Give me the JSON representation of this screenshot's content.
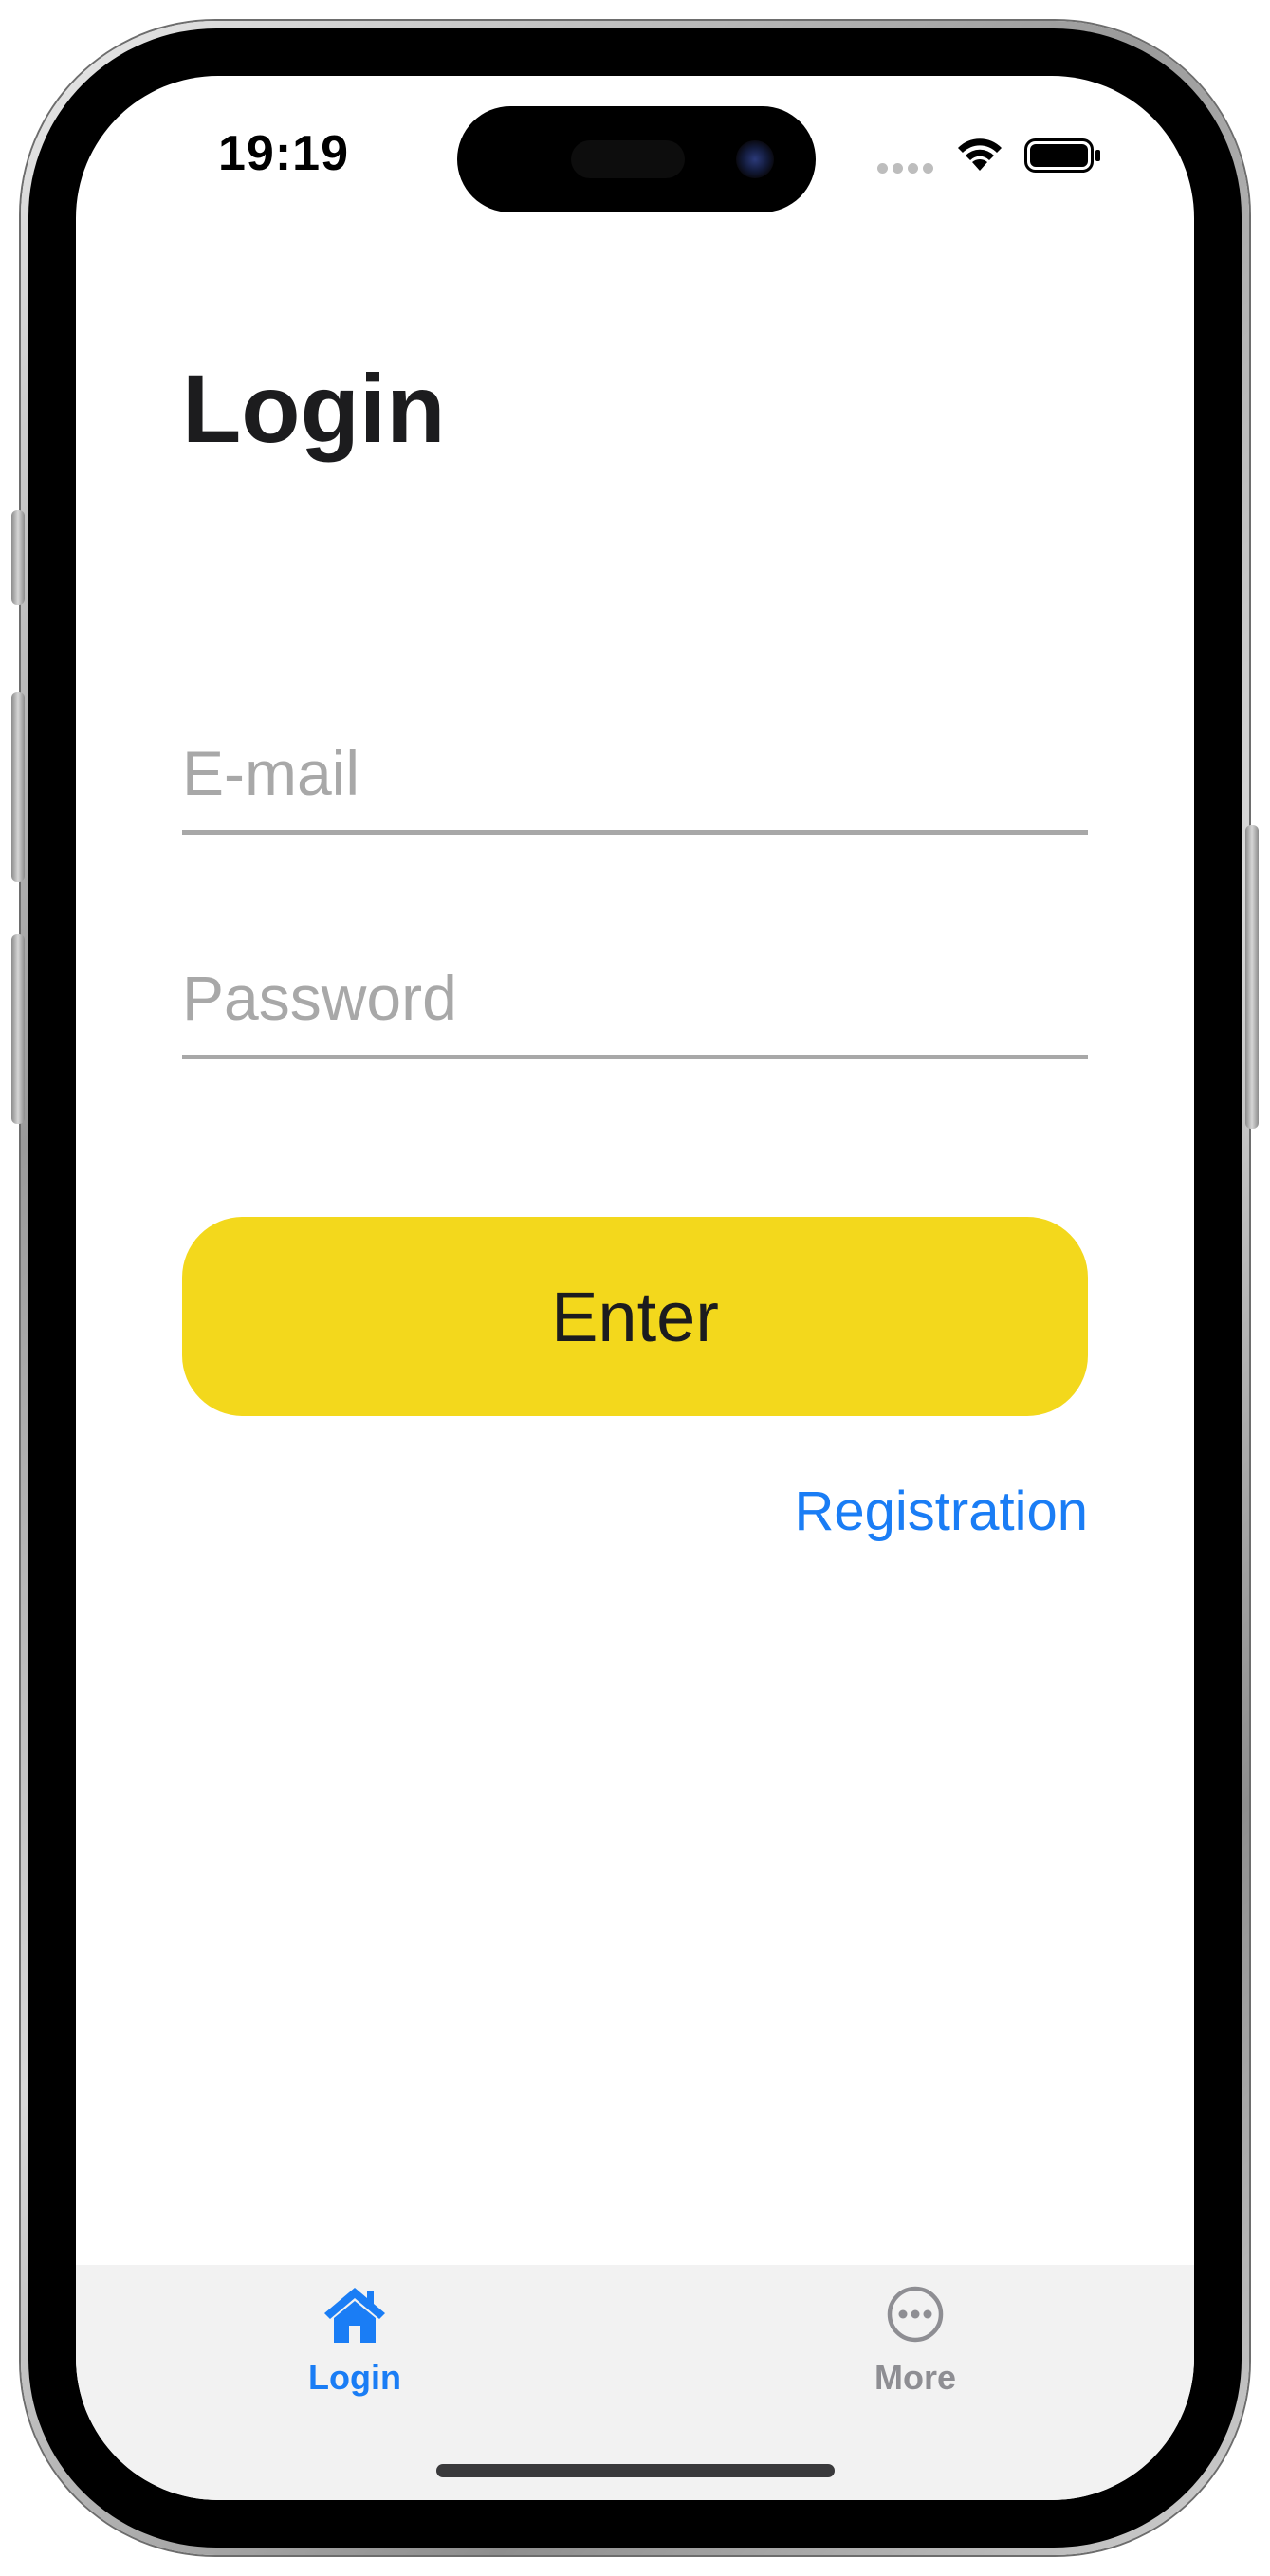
{
  "status_bar": {
    "time": "19:19"
  },
  "page": {
    "title": "Login"
  },
  "form": {
    "email_placeholder": "E-mail",
    "password_placeholder": "Password",
    "submit_label": "Enter",
    "registration_link": "Registration"
  },
  "tab_bar": {
    "tabs": [
      {
        "label": "Login",
        "icon": "house-icon",
        "active": true
      },
      {
        "label": "More",
        "icon": "ellipsis-circle-icon",
        "active": false
      }
    ]
  },
  "colors": {
    "accent": "#1a7df5",
    "button_background": "#f3d81c",
    "placeholder": "#a8a8a8",
    "tab_bar_background": "#f2f2f2"
  }
}
